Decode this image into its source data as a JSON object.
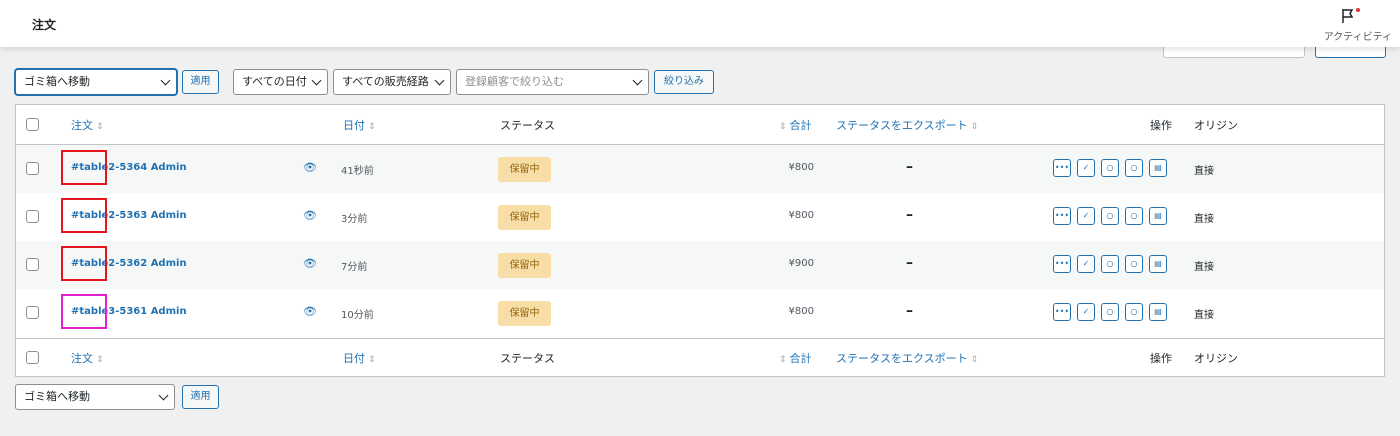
{
  "header": {
    "title": "注文",
    "activity_label": "アクティビティ"
  },
  "toolbar_top": {
    "bulk_action": "ゴミ箱へ移動",
    "apply_label": "適用",
    "date_filter": "すべての日付",
    "channel_filter": "すべての販売経路",
    "customer_placeholder": "登録顧客で絞り込む",
    "filter_label": "絞り込み"
  },
  "columns": {
    "order": "注文",
    "date": "日付",
    "status": "ステータス",
    "total": "合計",
    "export_status": "ステータスをエクスポート",
    "actions": "操作",
    "origin": "オリジン"
  },
  "sort_glyph": "⇕",
  "orders": [
    {
      "order": "#table2-5364 Admin",
      "date": "41秒前",
      "status": "保留中",
      "total": "¥800",
      "export": "–",
      "origin": "直接"
    },
    {
      "order": "#table2-5363 Admin",
      "date": "3分前",
      "status": "保留中",
      "total": "¥800",
      "export": "–",
      "origin": "直接"
    },
    {
      "order": "#table2-5362 Admin",
      "date": "7分前",
      "status": "保留中",
      "total": "¥900",
      "export": "–",
      "origin": "直接"
    },
    {
      "order": "#table3-5361 Admin",
      "date": "10分前",
      "status": "保留中",
      "total": "¥800",
      "export": "–",
      "origin": "直接"
    }
  ],
  "action_glyphs": [
    "•••",
    "✓",
    "○",
    "○",
    "▤"
  ],
  "toolbar_bottom": {
    "bulk_action": "ゴミ箱へ移動",
    "apply_label": "適用"
  },
  "colors": {
    "accent": "#2271b1",
    "badge_bg": "#f8dda7",
    "badge_text": "#94660c",
    "highlight_red": "#e0161c",
    "highlight_magenta": "#e51fd4"
  }
}
